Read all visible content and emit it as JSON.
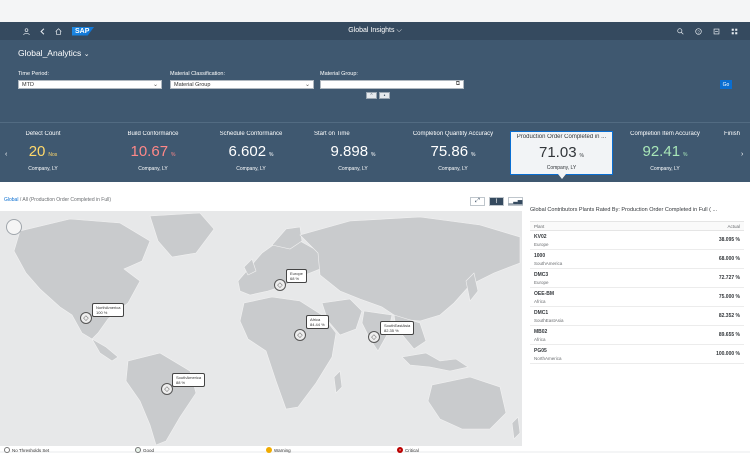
{
  "shell": {
    "logo": "SAP",
    "title": "Global Insights",
    "left_icons": [
      "user-icon",
      "back-icon",
      "home-icon"
    ],
    "right_icons": [
      "search-icon",
      "help-icon",
      "notifications-icon",
      "grid-icon"
    ]
  },
  "header": {
    "app_title": "Global_Analytics",
    "filters": [
      {
        "label": "Time Period:",
        "value": "MTD"
      },
      {
        "label": "Material Classification:",
        "value": "Material Group"
      },
      {
        "label": "Material Group:",
        "value": ""
      }
    ],
    "go_label": "Go"
  },
  "kpis": [
    {
      "title": "Defect Count",
      "value": "20",
      "unit": "Nos",
      "sub": "Company, LY",
      "color": "#ffd86b"
    },
    {
      "title": "Build Conformance",
      "value": "10.67",
      "unit": "%",
      "sub": "Company, LY",
      "color": "#ff8888"
    },
    {
      "title": "Schedule Conformance",
      "value": "6.602",
      "unit": "%",
      "sub": "Company, LY",
      "color": "#ffffff"
    },
    {
      "title": "Start on Time",
      "value": "9.898",
      "unit": "%",
      "sub": "Company, LY",
      "color": "#ffffff"
    },
    {
      "title": "Completion Quantity Accuracy",
      "value": "75.86",
      "unit": "%",
      "sub": "Company, LY",
      "color": "#ffffff"
    },
    {
      "title": "Production Order Completed in ...",
      "value": "71.03",
      "unit": "%",
      "sub": "Company, LY",
      "color": "#32363a",
      "selected": true
    },
    {
      "title": "Completion Item Accuracy",
      "value": "92.41",
      "unit": "%",
      "sub": "Company, LY",
      "color": "#a8e6b8"
    },
    {
      "title": "Finish",
      "value": "",
      "unit": "",
      "sub": "",
      "color": "#ffffff"
    }
  ],
  "breadcrumb": {
    "root": "Global",
    "current": "All (Production Order Completed in Full)"
  },
  "map": {
    "markers": [
      {
        "label": "NorthAmerica",
        "value": "100 %"
      },
      {
        "label": "Europe",
        "value": "68 %"
      },
      {
        "label": "Africa",
        "value": "84.44 %"
      },
      {
        "label": "SouthEastAsia",
        "value": "82.35 %"
      },
      {
        "label": "SouthAmerica",
        "value": "88 %"
      }
    ]
  },
  "legend": [
    {
      "label": "No Thresholds Set",
      "color": "#ffffff"
    },
    {
      "label": "Good",
      "color": "#e8f4ea"
    },
    {
      "label": "Warning",
      "color": "#f0ab00"
    },
    {
      "label": "Critical",
      "color": "#bb0000"
    }
  ],
  "panel": {
    "title": "Global Contributors Plants Rated By: Production Order Completed in Full ( ...",
    "col_plant": "Plant",
    "col_actual": "Actual",
    "rows": [
      {
        "plant": "KV02",
        "region": "Europe",
        "actual": "38.095 %"
      },
      {
        "plant": "1000",
        "region": "SouthAmerica",
        "actual": "68.000 %"
      },
      {
        "plant": "DMC3",
        "region": "Europe",
        "actual": "72.727 %"
      },
      {
        "plant": "OEE-BM",
        "region": "Africa",
        "actual": "75.000 %"
      },
      {
        "plant": "DMC1",
        "region": "SouthEastAsia",
        "actual": "82.352 %"
      },
      {
        "plant": "MB02",
        "region": "Africa",
        "actual": "89.655 %"
      },
      {
        "plant": "PG05",
        "region": "NorthAmerica",
        "actual": "100.000 %"
      }
    ]
  }
}
